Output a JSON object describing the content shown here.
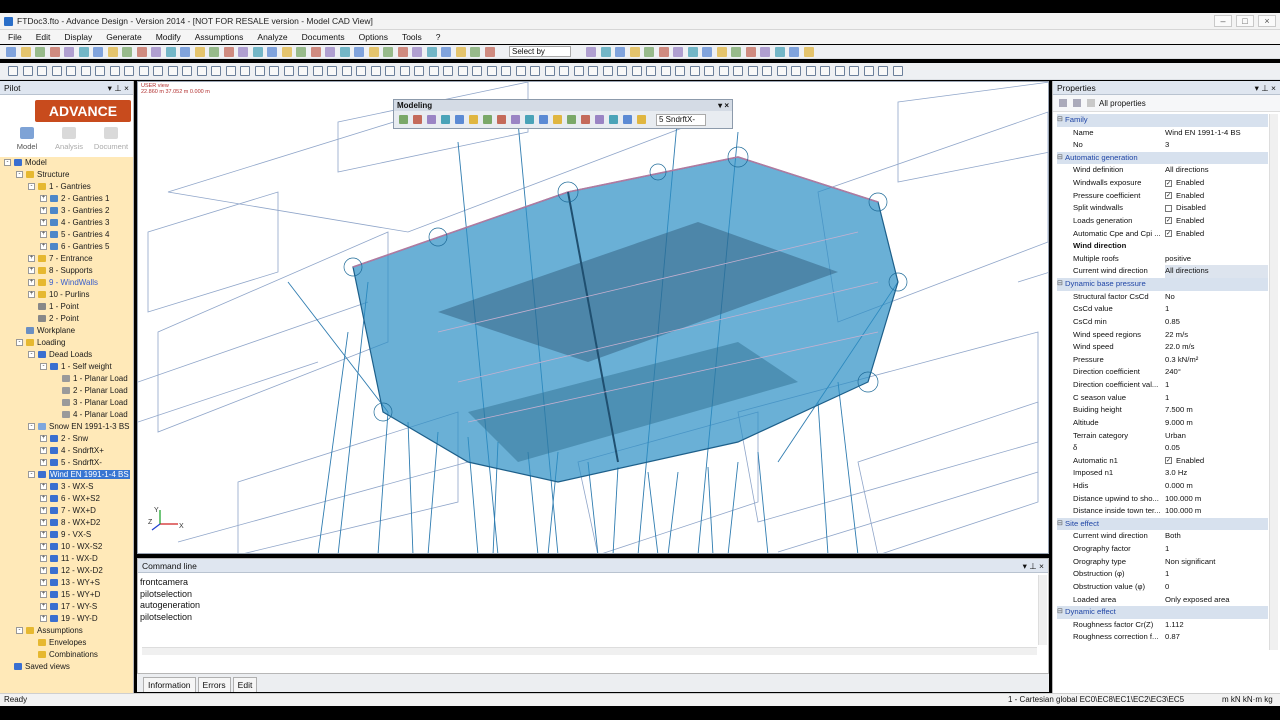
{
  "window": {
    "title": "FTDoc3.fto - Advance Design - Version 2014 - [NOT FOR RESALE version - Model CAD View]"
  },
  "menu": [
    "File",
    "Edit",
    "Display",
    "Generate",
    "Modify",
    "Assumptions",
    "Analyze",
    "Documents",
    "Options",
    "Tools",
    "?"
  ],
  "toolbar": {
    "select_label": "Select by"
  },
  "pilot": {
    "title": "Pilot",
    "logo_small": "GRAITEC",
    "logo": "ADVANCE",
    "tabs": [
      "Model",
      "Analysis",
      "Document"
    ],
    "tree": [
      {
        "label": "Model",
        "depth": 0,
        "ex": "-",
        "icon": "#3a6fd0"
      },
      {
        "label": "Structure",
        "depth": 1,
        "ex": "-",
        "icon": "#e6b830"
      },
      {
        "label": "1 - Gantries",
        "depth": 2,
        "ex": "-",
        "icon": "#e6b830"
      },
      {
        "label": "2 - Gantries 1",
        "depth": 3,
        "ex": "+",
        "icon": "#4d87c8"
      },
      {
        "label": "3 - Gantries 2",
        "depth": 3,
        "ex": "+",
        "icon": "#4d87c8"
      },
      {
        "label": "4 - Gantries 3",
        "depth": 3,
        "ex": "+",
        "icon": "#4d87c8"
      },
      {
        "label": "5 - Gantries 4",
        "depth": 3,
        "ex": "+",
        "icon": "#4d87c8"
      },
      {
        "label": "6 - Gantries 5",
        "depth": 3,
        "ex": "+",
        "icon": "#4d87c8"
      },
      {
        "label": "7 - Entrance",
        "depth": 2,
        "ex": "+",
        "icon": "#e6b830"
      },
      {
        "label": "8 - Supports",
        "depth": 2,
        "ex": "+",
        "icon": "#e6b830"
      },
      {
        "label": "9 - WindWalls",
        "depth": 2,
        "ex": "+",
        "icon": "#e6b830",
        "blue": true
      },
      {
        "label": "10 - Purlins",
        "depth": 2,
        "ex": "+",
        "icon": "#e6b830"
      },
      {
        "label": "1 - Point",
        "depth": 2,
        "ex": "",
        "icon": "#888"
      },
      {
        "label": "2 - Point",
        "depth": 2,
        "ex": "",
        "icon": "#888"
      },
      {
        "label": "Workplane",
        "depth": 1,
        "ex": "",
        "icon": "#6b8fc2"
      },
      {
        "label": "Loading",
        "depth": 1,
        "ex": "-",
        "icon": "#e6b830"
      },
      {
        "label": "Dead Loads",
        "depth": 2,
        "ex": "-",
        "icon": "#3a6fd0"
      },
      {
        "label": "1 - Self weight",
        "depth": 3,
        "ex": "-",
        "icon": "#3a6fd0"
      },
      {
        "label": "1 - Planar Load",
        "depth": 4,
        "ex": "",
        "icon": "#9a9a9a"
      },
      {
        "label": "2 - Planar Load",
        "depth": 4,
        "ex": "",
        "icon": "#9a9a9a"
      },
      {
        "label": "3 - Planar Load",
        "depth": 4,
        "ex": "",
        "icon": "#9a9a9a"
      },
      {
        "label": "4 - Planar Load",
        "depth": 4,
        "ex": "",
        "icon": "#9a9a9a"
      },
      {
        "label": "Snow EN 1991-1-3 BS",
        "depth": 2,
        "ex": "-",
        "icon": "#7fa7dd"
      },
      {
        "label": "2 - Snw",
        "depth": 3,
        "ex": "+",
        "icon": "#3a6fd0"
      },
      {
        "label": "4 - SndrftX+",
        "depth": 3,
        "ex": "+",
        "icon": "#3a6fd0"
      },
      {
        "label": "5 - SndrftX-",
        "depth": 3,
        "ex": "+",
        "icon": "#3a6fd0"
      },
      {
        "label": "Wind EN 1991-1-4 BS",
        "depth": 2,
        "ex": "-",
        "icon": "#3a6fd0",
        "selected": true
      },
      {
        "label": "3 - WX-S",
        "depth": 3,
        "ex": "+",
        "icon": "#3a6fd0"
      },
      {
        "label": "6 - WX+S2",
        "depth": 3,
        "ex": "+",
        "icon": "#3a6fd0"
      },
      {
        "label": "7 - WX+D",
        "depth": 3,
        "ex": "+",
        "icon": "#3a6fd0"
      },
      {
        "label": "8 - WX+D2",
        "depth": 3,
        "ex": "+",
        "icon": "#3a6fd0"
      },
      {
        "label": "9 - VX-S",
        "depth": 3,
        "ex": "+",
        "icon": "#3a6fd0"
      },
      {
        "label": "10 - WX-S2",
        "depth": 3,
        "ex": "+",
        "icon": "#3a6fd0"
      },
      {
        "label": "11 - WX-D",
        "depth": 3,
        "ex": "+",
        "icon": "#3a6fd0"
      },
      {
        "label": "12 - WX-D2",
        "depth": 3,
        "ex": "+",
        "icon": "#3a6fd0"
      },
      {
        "label": "13 - WY+S",
        "depth": 3,
        "ex": "+",
        "icon": "#3a6fd0"
      },
      {
        "label": "15 - WY+D",
        "depth": 3,
        "ex": "+",
        "icon": "#3a6fd0"
      },
      {
        "label": "17 - WY-S",
        "depth": 3,
        "ex": "+",
        "icon": "#3a6fd0"
      },
      {
        "label": "19 - WY-D",
        "depth": 3,
        "ex": "+",
        "icon": "#3a6fd0"
      },
      {
        "label": "Assumptions",
        "depth": 1,
        "ex": "-",
        "icon": "#e6b830"
      },
      {
        "label": "Envelopes",
        "depth": 2,
        "ex": "",
        "icon": "#e6b830"
      },
      {
        "label": "Combinations",
        "depth": 2,
        "ex": "",
        "icon": "#e6b830"
      },
      {
        "label": "Saved views",
        "depth": 0,
        "ex": "",
        "icon": "#3a6fd0"
      }
    ]
  },
  "viewport": {
    "view_name": "USER view",
    "coords": "22.860 m  37.052 m  0.000 m"
  },
  "modeling": {
    "title": "Modeling",
    "combo": "5  SndrftX-"
  },
  "command": {
    "title": "Command line",
    "lines": [
      "frontcamera",
      "pilotselection",
      "autogeneration",
      "pilotselection"
    ],
    "tabs": [
      "Information",
      "Errors",
      "Edit"
    ]
  },
  "properties": {
    "title": "Properties",
    "filter": "All properties",
    "rows": [
      {
        "type": "sec",
        "name": "Family"
      },
      {
        "name": "Name",
        "value": "Wind EN 1991-1-4 BS"
      },
      {
        "name": "No",
        "value": "3"
      },
      {
        "type": "sec",
        "name": "Automatic generation"
      },
      {
        "name": "Wind definition",
        "value": "All directions"
      },
      {
        "name": "Windwalls exposure",
        "value": "Enabled",
        "check": true
      },
      {
        "name": "Pressure coefficient",
        "value": "Enabled",
        "check": true
      },
      {
        "name": "Split windwalls",
        "value": "Disabled",
        "check": false
      },
      {
        "name": "Loads generation",
        "value": "Enabled",
        "check": true
      },
      {
        "name": "Automatic Cpe and Cpi ...",
        "value": "Enabled",
        "check": true
      },
      {
        "type": "bold",
        "name": "Wind direction",
        "value": ""
      },
      {
        "name": "Multiple roofs",
        "value": "positive"
      },
      {
        "name": "Current wind direction",
        "value": "All directions",
        "hl": true
      },
      {
        "type": "sec",
        "name": "Dynamic base pressure"
      },
      {
        "name": "Structural factor CsCd",
        "value": "No"
      },
      {
        "name": "CsCd value",
        "value": "1"
      },
      {
        "name": "CsCd min",
        "value": "0.85"
      },
      {
        "name": "Wind speed regions",
        "value": "22 m/s"
      },
      {
        "name": "Wind speed",
        "value": "22.0 m/s"
      },
      {
        "name": "Pressure",
        "value": "0.3 kN/m²"
      },
      {
        "name": "Direction coefficient",
        "value": "240°"
      },
      {
        "name": "Direction coefficient val...",
        "value": "1"
      },
      {
        "name": "C season value",
        "value": "1"
      },
      {
        "name": "Buiding height",
        "value": "7.500 m"
      },
      {
        "name": "Altitude",
        "value": "9.000 m"
      },
      {
        "name": "Terrain category",
        "value": "Urban"
      },
      {
        "name": "δ",
        "value": "0.05"
      },
      {
        "name": "Automatic n1",
        "value": "Enabled",
        "check": true
      },
      {
        "name": "Imposed n1",
        "value": "3.0 Hz"
      },
      {
        "name": "Hdis",
        "value": "0.000 m"
      },
      {
        "name": "Distance upwind to sho...",
        "value": "100.000 m"
      },
      {
        "name": "Distance inside town ter...",
        "value": "100.000 m"
      },
      {
        "type": "sec",
        "name": "Site effect"
      },
      {
        "name": "Current wind direction",
        "value": "Both"
      },
      {
        "name": "Orography factor",
        "value": "1"
      },
      {
        "name": "Orography type",
        "value": "Non significant"
      },
      {
        "name": "Obstruction (φ)",
        "value": "1"
      },
      {
        "name": "Obstruction value (φ)",
        "value": "0"
      },
      {
        "name": "Loaded area",
        "value": "Only exposed area"
      },
      {
        "type": "sec",
        "name": "Dynamic effect"
      },
      {
        "name": "Roughness factor Cr(Z)",
        "value": "1.112"
      },
      {
        "name": "Roughness correction f...",
        "value": "0.87"
      }
    ]
  },
  "status": {
    "left": "Ready",
    "right": "1 - Cartesian global  EC0\\EC8\\EC1\\EC2\\EC3\\EC5",
    "units": "m  kN  kN·m  kg"
  }
}
